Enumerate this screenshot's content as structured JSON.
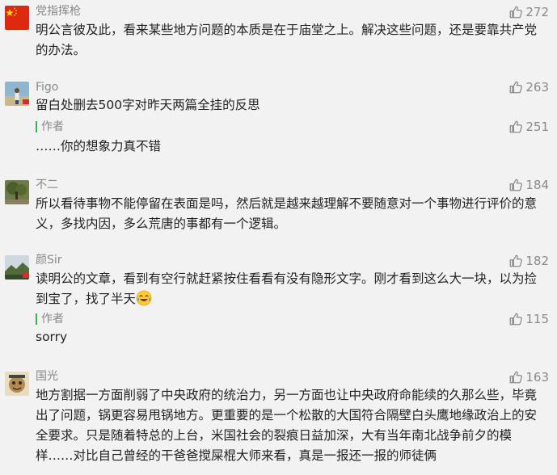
{
  "comments": [
    {
      "nickname": "党指挥枪",
      "likes": "272",
      "content": "明公言彼及此，看来某些地方问题的本质是在于庙堂之上。解决这些问题，还是要靠共产党的办法。"
    },
    {
      "nickname": "Figo",
      "likes": "263",
      "content": "留白处删去500字对昨天两篇全挂的反思",
      "reply": {
        "author_label": "作者",
        "likes": "251",
        "content": "……你的想象力真不错"
      }
    },
    {
      "nickname": "不二",
      "likes": "184",
      "content": "所以看待事物不能停留在表面是吗，然后就是越来越理解不要随意对一个事物进行评价的意义，多找内因，多么荒唐的事都有一个逻辑。"
    },
    {
      "nickname": "颜Sir",
      "likes": "182",
      "content": "读明公的文章，看到有空行就赶紧按住看看有没有隐形文字。刚才看到这么大一块，以为捡到宝了，找了半天",
      "content_emoji": "crying-laughing-emoji",
      "reply": {
        "author_label": "作者",
        "likes": "115",
        "content": "sorry"
      }
    },
    {
      "nickname": "国光",
      "likes": "163",
      "content": "地方割据一方面削弱了中央政府的统治力，另一方面也让中央政府命能续的久那么些，毕竟出了问题，锅更容易甩锅地方。更重要的是一个松散的大国符合隔壁白头鹰地缘政治上的安全要求。只是随着特总的上台，米国社会的裂痕日益加深，大有当年南北战争前夕的模样……对比自己曾经的干爸爸搅屎棍大师来看，真是一报还一报的师徒俩"
    }
  ],
  "icons": {
    "like": "thumbs-up-icon",
    "avatars": [
      "china-flag-avatar",
      "person-photo-avatar",
      "tree-photo-avatar",
      "landscape-photo-avatar",
      "cartoon-avatar"
    ]
  },
  "colors": {
    "background": "#f2f2f2",
    "author_bar": "#2fb45a",
    "flag_red": "#de2910",
    "flag_star": "#ffde00"
  }
}
